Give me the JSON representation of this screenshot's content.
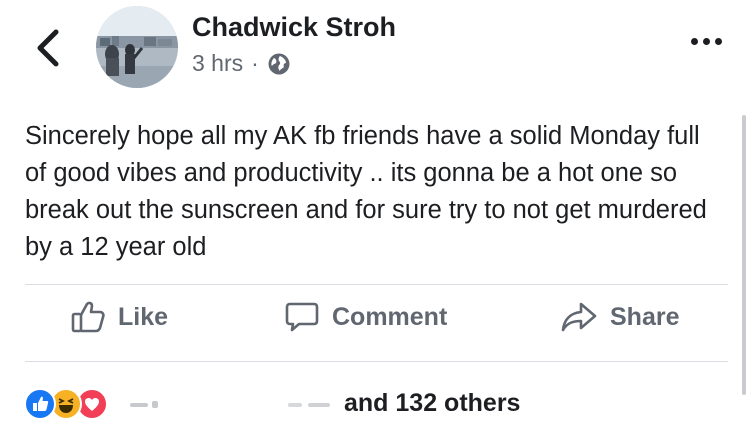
{
  "header": {
    "author_name": "Chadwick Stroh",
    "timestamp": "3 hrs",
    "separator": "·",
    "audience_icon": "globe-icon",
    "back_icon": "chevron-left-icon",
    "more_icon": "more-horizontal-icon"
  },
  "post": {
    "text": "Sincerely hope all my AK fb friends have a solid Monday full of good vibes and productivity .. its gonna be a hot one so break out the sunscreen and for sure try to not get murdered by a 12 year old"
  },
  "actions": {
    "like": "Like",
    "comment": "Comment",
    "share": "Share"
  },
  "reactions": {
    "icons": [
      "like-reaction-icon",
      "haha-reaction-icon",
      "love-reaction-icon"
    ],
    "summary": "and 132 others"
  },
  "colors": {
    "text": "#1c1e21",
    "secondary": "#606770",
    "like_blue": "#1877f2",
    "haha_yellow": "#f7b125",
    "love_red": "#f33e58",
    "divider": "#dadde1"
  }
}
